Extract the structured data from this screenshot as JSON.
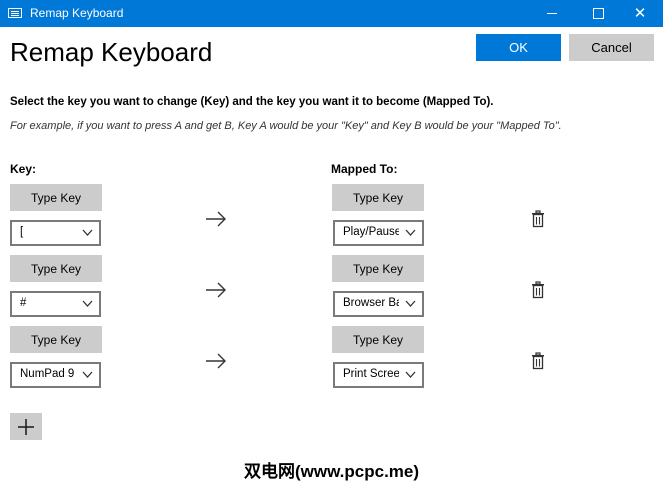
{
  "window": {
    "title": "Remap Keyboard"
  },
  "header": {
    "title": "Remap Keyboard",
    "ok_label": "OK",
    "cancel_label": "Cancel"
  },
  "instructions": {
    "main": "Select the key you want to change (Key) and the key you want it to become (Mapped To).",
    "example": "For example, if you want to press A and get B, Key A would be your \"Key\" and Key B would be your \"Mapped To\"."
  },
  "columns": {
    "key": "Key:",
    "mapped": "Mapped To:"
  },
  "type_key_label": "Type Key",
  "rows": [
    {
      "key": "[",
      "mapped": "Play/Pause"
    },
    {
      "key": "#",
      "mapped": "Browser Ba"
    },
    {
      "key": "NumPad 9",
      "mapped": "Print Scree"
    }
  ],
  "watermark": "双电网(www.pcpc.me)",
  "colors": {
    "accent": "#0078d7",
    "button_gray": "#cccccc"
  }
}
